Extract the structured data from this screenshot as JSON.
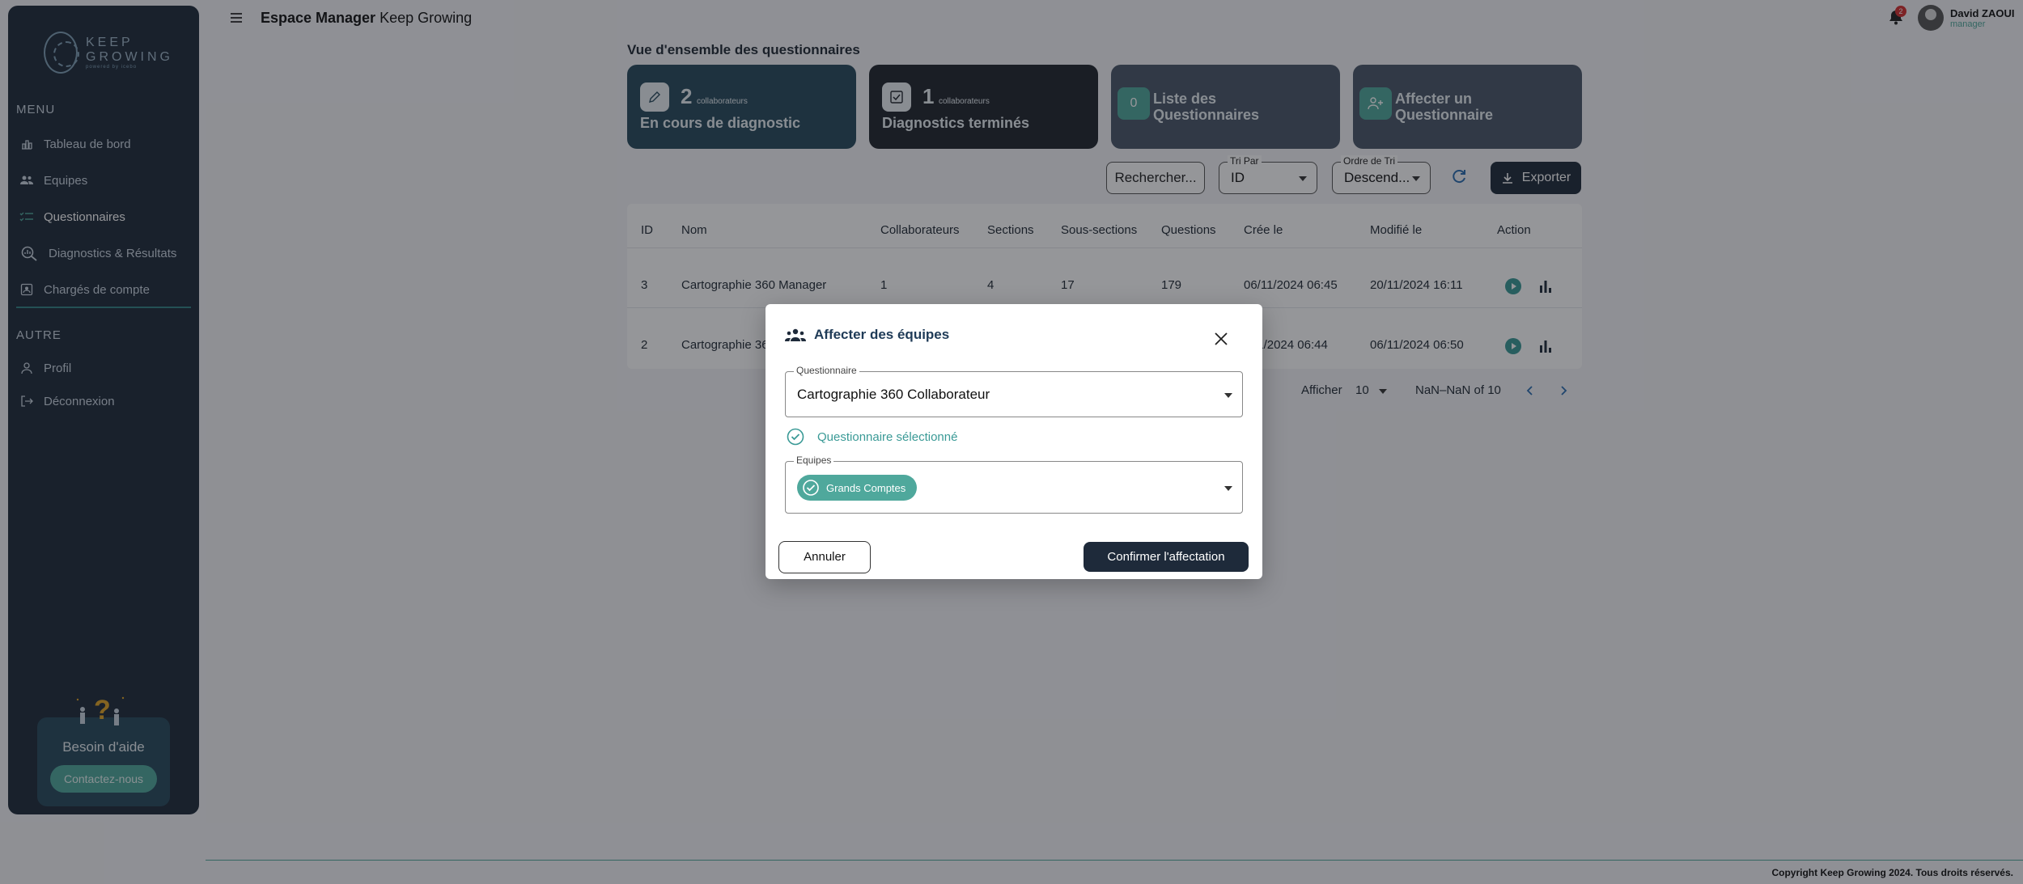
{
  "header": {
    "app_title_bold": "Espace Manager",
    "app_title_rest": "Keep Growing",
    "notification_count": "2",
    "user_name": "David ZAOUI",
    "user_role": "manager"
  },
  "sidebar": {
    "logo_line1": "KEEP",
    "logo_line2": "GROWING",
    "logo_tagline": "powered by icebo",
    "menu_label": "MENU",
    "items": [
      {
        "label": "Tableau de bord",
        "icon": "chart-bar-icon"
      },
      {
        "label": "Equipes",
        "icon": "users-icon"
      },
      {
        "label": "Questionnaires",
        "icon": "checklist-icon"
      },
      {
        "label": "Diagnostics & Résultats",
        "icon": "search-analytics-icon"
      },
      {
        "label": "Chargés de compte",
        "icon": "account-manager-icon"
      }
    ],
    "other_label": "AUTRE",
    "other_items": [
      {
        "label": "Profil",
        "icon": "user-icon"
      },
      {
        "label": "Déconnexion",
        "icon": "logout-icon"
      }
    ],
    "help_title": "Besoin d'aide",
    "help_button": "Contactez-nous"
  },
  "main": {
    "heading": "Vue d'ensemble des questionnaires",
    "cards": [
      {
        "number": "2",
        "unit": "collaborateurs",
        "label": "En cours de diagnostic",
        "bg": "#274a5c"
      },
      {
        "number": "1",
        "unit": "collaborateurs",
        "label": "Diagnostics terminés",
        "bg": "#20252d"
      },
      {
        "badge": "0",
        "label": "Liste des Questionnaires",
        "bg": "#4a5668"
      },
      {
        "label": "Affecter un Questionnaire",
        "bg": "#4a5668"
      }
    ],
    "search_label": "Rechercher...",
    "sort_by": {
      "legend": "Tri Par",
      "value": "ID"
    },
    "sort_order": {
      "legend": "Ordre de Tri",
      "value": "Descend..."
    },
    "export_label": "Exporter",
    "table": {
      "headers": [
        "ID",
        "Nom",
        "Collaborateurs",
        "Sections",
        "Sous-sections",
        "Questions",
        "Crée le",
        "Modifié le",
        "Action"
      ],
      "rows": [
        [
          "3",
          "Cartographie 360 Manager",
          "1",
          "4",
          "17",
          "179",
          "06/11/2024 06:45",
          "20/11/2024 16:11"
        ],
        [
          "2",
          "Cartographie 36",
          "",
          "",
          "",
          "",
          "11/2024 06:44",
          "06/11/2024 06:50"
        ]
      ]
    },
    "pagination": {
      "rows_label": "Afficher",
      "rows_value": "10",
      "range": "NaN–NaN of 10"
    }
  },
  "modal": {
    "title": "Affecter des équipes",
    "questionnaire_legend": "Questionnaire",
    "questionnaire_value": "Cartographie 360 Collaborateur",
    "selected_note": "Questionnaire sélectionné",
    "teams_legend": "Equipes",
    "team_chip": "Grands Comptes",
    "cancel": "Annuler",
    "confirm": "Confirmer l'affectation"
  },
  "footer": {
    "copyright": "Copyright Keep Growing 2024. Tous droits réservés."
  },
  "colors": {
    "accent": "#4fa89c",
    "navy": "#1e2a3a",
    "teal_text": "#3a9a96"
  }
}
